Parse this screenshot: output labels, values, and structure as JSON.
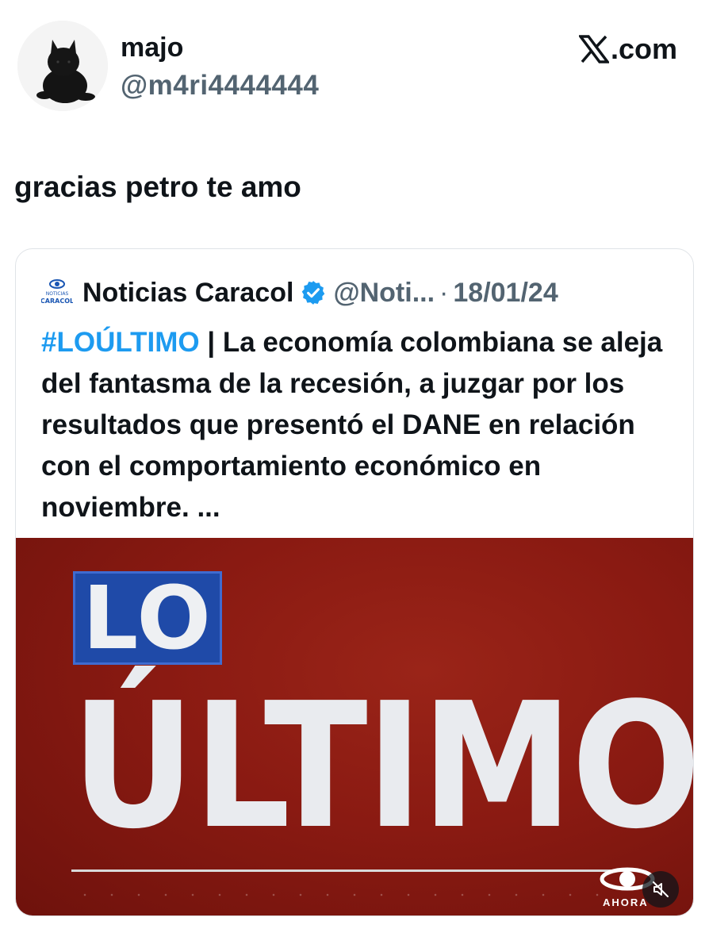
{
  "author": {
    "display_name": "majo",
    "handle": "@m4ri4444444",
    "avatar_icon": "black-cat-avatar"
  },
  "source": {
    "label": ".com",
    "icon": "x-logo-icon"
  },
  "tweet": {
    "text": "gracias petro te amo"
  },
  "quoted_tweet": {
    "display_name": "Noticias Caracol",
    "logo_icon": "noticias-caracol-logo",
    "verified_icon": "verified-badge-icon",
    "handle": "@Noti...",
    "separator": "·",
    "date": "18/01/24",
    "hashtag": "#LOÚLTIMO",
    "body": " | La economía colombiana se aleja del fantasma de la recesión, a juzgar por los resultados que presentó el DANE en relación con el comportamiento económico en noviembre. ..."
  },
  "media": {
    "title_top": "LO",
    "title_bottom": "ÚLTIMO",
    "channel_label": "AHORA",
    "mute_icon": "mute-icon",
    "colors": {
      "background": "#8a1a12",
      "box": "#1f4aa8",
      "text": "#eef0f3"
    }
  },
  "colors": {
    "text_primary": "#0f1419",
    "text_secondary": "#536471",
    "link": "#1d9bf0",
    "border": "#dfe3e7"
  }
}
